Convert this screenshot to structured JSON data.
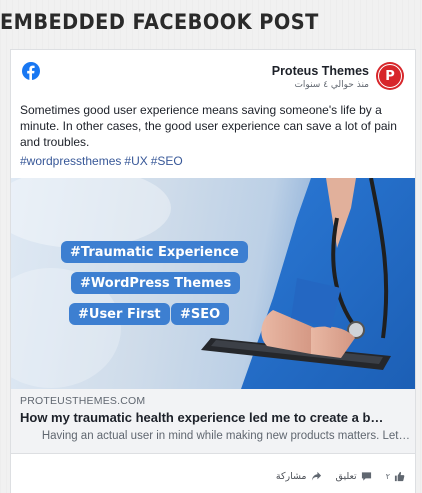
{
  "section": {
    "title": "EMBEDDED FACEBOOK POST"
  },
  "post": {
    "page_name": "Proteus Themes",
    "avatar_letter": "P",
    "time": "منذ حوالي ٤ سنوات",
    "text": "Sometimes good user experience means saving someone's life by a minute. In other cases, the good user experience can save a lot of pain and troubles.",
    "hashtags": [
      "#wordpressthemes",
      "#UX",
      "#SEO"
    ]
  },
  "link": {
    "image_tags": [
      "#Traumatic Experience",
      "#WordPress Themes",
      "#User First",
      "#SEO"
    ],
    "domain": "PROTEUSTHEMES.COM",
    "title": "How my traumatic health experience led me to create a b…",
    "description": "…Having an actual user in mind while making new products matters. Let"
  },
  "actions": {
    "like_count": "٢",
    "comment_label": "تعليق",
    "share_label": "مشاركة"
  },
  "colors": {
    "facebook_blue": "#1877f2",
    "brand_red": "#d7262a",
    "hashtag_link": "#385898",
    "tag_blue": "#3d7fd1"
  },
  "icons": {
    "facebook": "facebook-logo-icon",
    "like": "thumbs-up-icon",
    "comment": "comment-icon",
    "share": "share-icon"
  }
}
